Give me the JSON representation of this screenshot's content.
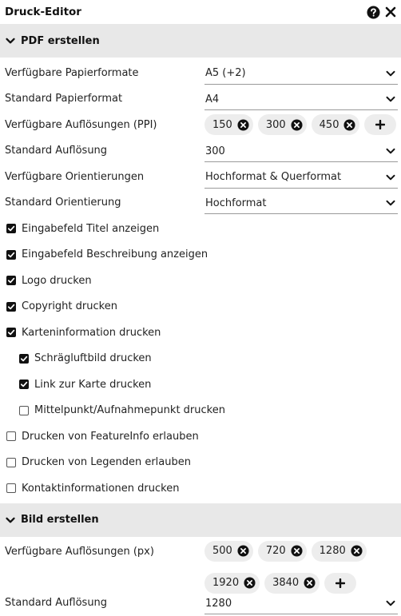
{
  "app": {
    "title": "Druck-Editor"
  },
  "pdf_section": {
    "title": "PDF erstellen",
    "fields": [
      {
        "label": "Verfügbare Papierformate",
        "value": "A5 (+2)"
      },
      {
        "label": "Standard Papierformat",
        "value": "A4"
      },
      {
        "label": "Verfügbare Auflösungen (PPI)",
        "chips": [
          "150",
          "300",
          "450"
        ]
      },
      {
        "label": "Standard Auflösung",
        "value": "300"
      },
      {
        "label": "Verfügbare Orientierungen",
        "value": "Hochformat & Querformat"
      },
      {
        "label": "Standard Orientierung",
        "value": "Hochformat"
      }
    ],
    "checkboxes": [
      {
        "label": "Eingabefeld Titel anzeigen",
        "checked": true
      },
      {
        "label": "Eingabefeld Beschreibung anzeigen",
        "checked": true
      },
      {
        "label": "Logo drucken",
        "checked": true
      },
      {
        "label": "Copyright drucken",
        "checked": true
      },
      {
        "label": "Karteninformation drucken",
        "checked": true
      },
      {
        "label": "Schrägluftbild drucken",
        "checked": true
      },
      {
        "label": "Link zur Karte drucken",
        "checked": true
      },
      {
        "label": "Mittelpunkt/Aufnahmepunkt drucken",
        "checked": false
      },
      {
        "label": "Drucken von FeatureInfo erlauben",
        "checked": false
      },
      {
        "label": "Drucken von Legenden erlauben",
        "checked": false
      },
      {
        "label": "Kontaktinformationen drucken",
        "checked": false
      }
    ]
  },
  "image_section": {
    "title": "Bild erstellen",
    "resolutions_label": "Verfügbare Auflösungen (px)",
    "resolutions": [
      "500",
      "720",
      "1280",
      "1920",
      "3840"
    ],
    "default_label": "Standard Auflösung",
    "default_value": "1280"
  },
  "icons": {
    "help": "help-circle-icon",
    "close": "close-icon",
    "section_toggle": "chevron-down-icon",
    "select_arrow": "chevron-down-icon",
    "chip_remove": "remove-circle-icon",
    "add": "plus-icon",
    "check": "check-icon"
  }
}
